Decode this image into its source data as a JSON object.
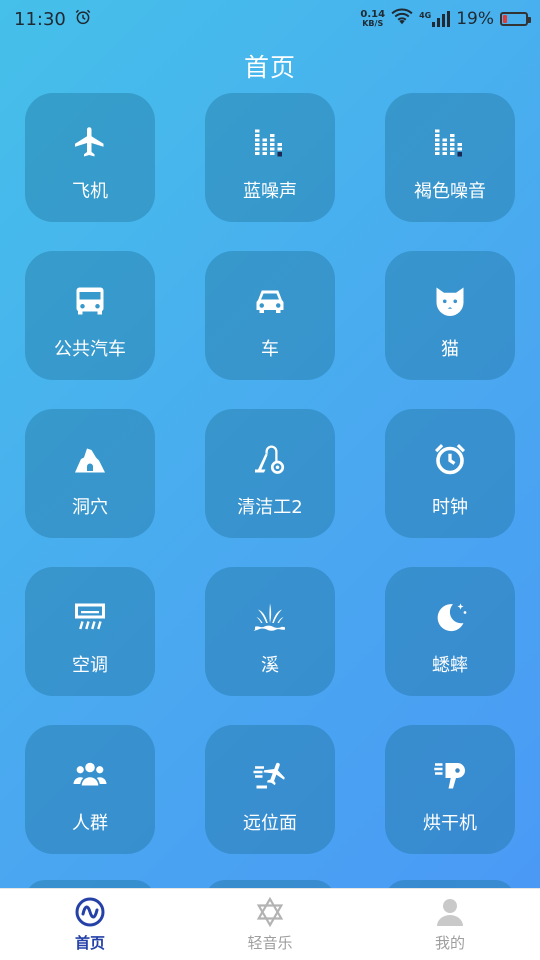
{
  "status_bar": {
    "time": "11:30",
    "net_speed": "0.14",
    "net_unit": "KB/S",
    "network": "4G",
    "battery_percent": "19%",
    "battery_level": 0.19
  },
  "page_title": "首页",
  "tiles": [
    {
      "label": "飞机",
      "icon": "airplane-icon"
    },
    {
      "label": "蓝噪声",
      "icon": "equalizer-icon"
    },
    {
      "label": "褐色噪音",
      "icon": "equalizer-icon"
    },
    {
      "label": "公共汽车",
      "icon": "bus-icon"
    },
    {
      "label": "车",
      "icon": "car-icon"
    },
    {
      "label": "猫",
      "icon": "cat-icon"
    },
    {
      "label": "洞穴",
      "icon": "cave-icon"
    },
    {
      "label": "清洁工2",
      "icon": "vacuum-icon"
    },
    {
      "label": "时钟",
      "icon": "alarm-clock-icon"
    },
    {
      "label": "空调",
      "icon": "air-conditioner-icon"
    },
    {
      "label": "溪",
      "icon": "grass-stream-icon"
    },
    {
      "label": "蟋蟀",
      "icon": "moon-icon"
    },
    {
      "label": "人群",
      "icon": "crowd-icon"
    },
    {
      "label": "远位面",
      "icon": "fan-plane-icon"
    },
    {
      "label": "烘干机",
      "icon": "hair-dryer-icon"
    }
  ],
  "bottom_nav": [
    {
      "label": "首页",
      "icon": "home-wave-icon",
      "active": true
    },
    {
      "label": "轻音乐",
      "icon": "star-of-david-icon",
      "active": false
    },
    {
      "label": "我的",
      "icon": "user-icon",
      "active": false
    }
  ],
  "colors": {
    "accent": "#2541a8",
    "battery_low": "#e53935"
  }
}
